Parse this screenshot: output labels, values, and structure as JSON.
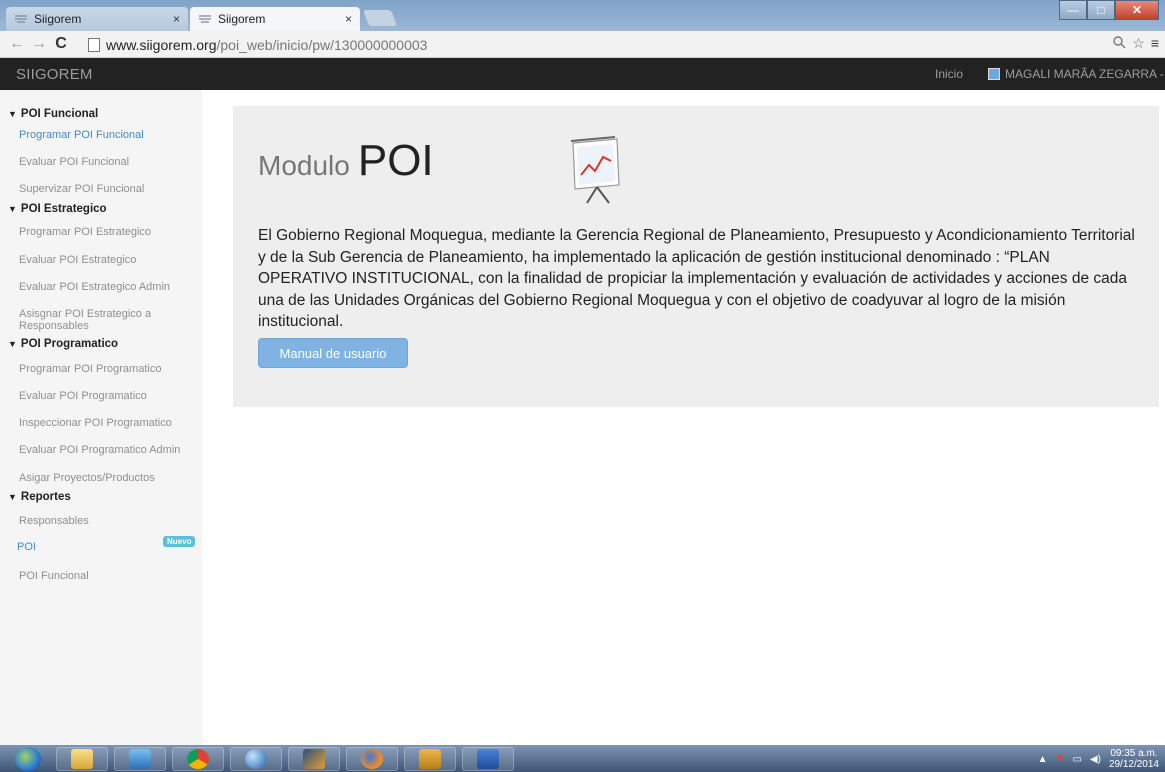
{
  "browser": {
    "tabs": [
      {
        "title": "Siigorem",
        "active": false
      },
      {
        "title": "Siigorem",
        "active": true
      }
    ],
    "close_glyph": "×",
    "url_domain": "www.siigorem.org",
    "url_path": "/poi_web/inicio/pw/130000000003",
    "nav_back": "←",
    "nav_forward": "→",
    "nav_reload": "C",
    "zoom_icon": "magnifier-icon",
    "star_icon": "☆",
    "menu_icon": "≡"
  },
  "navbar": {
    "brand": "SIIGOREM",
    "link_inicio": "Inicio",
    "user_name": "MAGALI MARÃA ZEGARRA -"
  },
  "sidebar": {
    "sections": [
      {
        "title": "POI Funcional",
        "items": [
          "Programar POI Funcional",
          "Evaluar POI Funcional",
          "Supervizar POI Funcional"
        ]
      },
      {
        "title": "POI Estrategico",
        "items": [
          "Programar POI Estrategico",
          "Evaluar POI Estrategico",
          "Evaluar POI Estrategico Admin",
          "Asisgnar POI Estrategico a Responsables"
        ]
      },
      {
        "title": "POI Programatico",
        "items": [
          "Programar POI Programatico",
          "Evaluar POI Programatico",
          "Inspeccionar POI Programatico",
          "Evaluar POI Programatico Admin",
          "Asigar Proyectos/Productos"
        ]
      },
      {
        "title": "Reportes",
        "items": [
          "Responsables",
          "POI",
          "POI Funcional"
        ]
      }
    ],
    "badge_nuevo": "Nuevo",
    "chevron": "❯"
  },
  "main": {
    "title_light": "Modulo",
    "title_bold": "POI",
    "description": "El Gobierno Regional Moquegua, mediante la Gerencia Regional de Planeamiento, Presupuesto y Acondicionamiento Territorial y de la Sub Gerencia de Planeamiento, ha implementado la aplicación de gestión institucional denominado : “PLAN OPERATIVO INSTITUCIONAL, con la finalidad de propiciar la implementación y evaluación de actividades y acciones de cada una de las Unidades Orgánicas del Gobierno Regional Moquegua y con el objetivo de coadyuvar al logro de la misión institucional.",
    "manual_button": "Manual de usuario"
  },
  "taskbar": {
    "clock_time": "09:35 a.m.",
    "clock_date": "29/12/2014",
    "apps": [
      "start-orb",
      "file-explorer",
      "media-player",
      "chrome",
      "google-earth",
      "app-icon",
      "firefox",
      "screen-app",
      "word"
    ]
  },
  "colors": {
    "navbar_bg": "#222222",
    "link_active": "#428bca",
    "button_primary": "#7fb3e4",
    "badge": "#5bc0de",
    "jumbotron_bg": "#eeeeee"
  }
}
